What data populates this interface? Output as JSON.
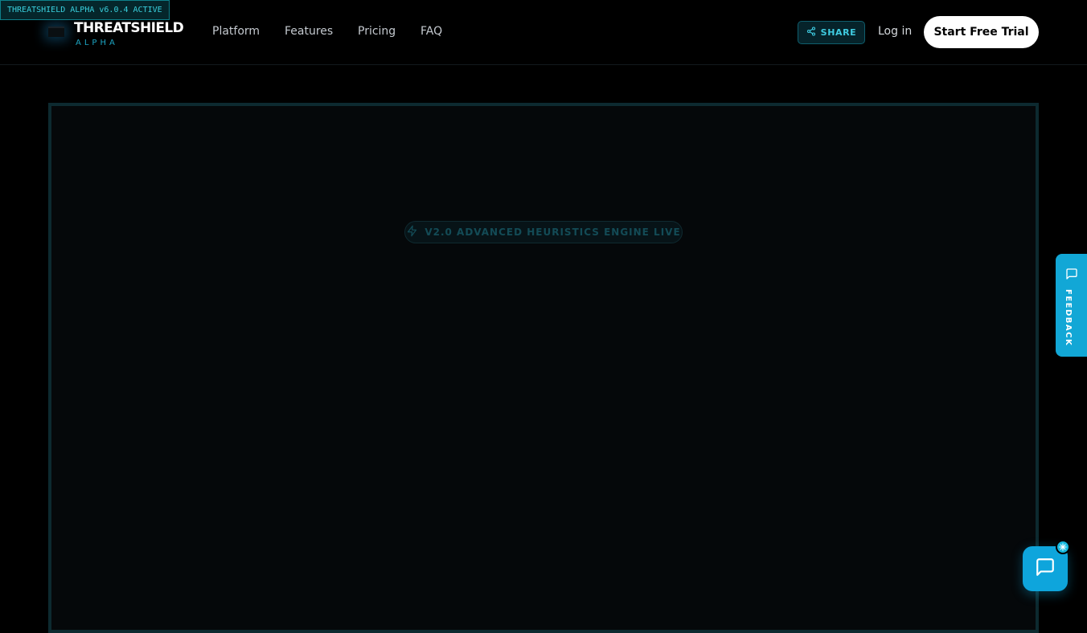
{
  "version_badge": "THREATSHIELD ALPHA v6.0.4 ACTIVE",
  "brand": {
    "title": "THREATSHIELD",
    "subtitle": "ALPHA"
  },
  "nav": {
    "items": [
      {
        "label": "Platform"
      },
      {
        "label": "Features"
      },
      {
        "label": "Pricing"
      },
      {
        "label": "FAQ"
      }
    ]
  },
  "actions": {
    "share_label": "SHARE",
    "share_icon": "share-icon",
    "login_label": "Log in",
    "trial_label": "Start Free Trial"
  },
  "hero": {
    "pill_label": "V2.0 ADVANCED HEURISTICS ENGINE LIVE",
    "pill_icon": "lightning-icon"
  },
  "feedback": {
    "label": "FEEDBACK",
    "icon": "message-square-icon"
  },
  "chat": {
    "icon": "chat-bubble-icon",
    "badge_icon": "sparkle-icon"
  },
  "colors": {
    "background": "#000000",
    "accent": "#12a7d6",
    "badge_text": "#39d0de",
    "frame_border": "#0d2a30",
    "cta_background": "#ffffff"
  }
}
